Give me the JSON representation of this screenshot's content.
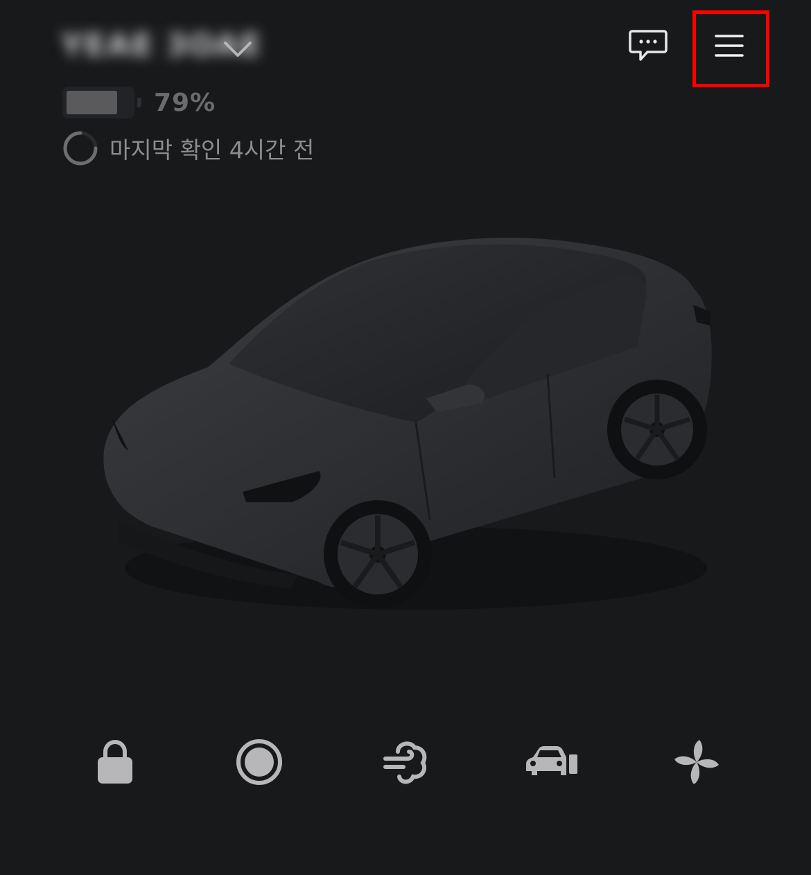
{
  "header": {
    "vehicle_name": "YEAE 3OAE",
    "vehicle_selector_icon": "chevron-down-icon",
    "messages_icon": "chat-bubble-icon",
    "menu_icon": "hamburger-menu-icon"
  },
  "battery": {
    "percent_label": "79%",
    "level": 0.79
  },
  "status": {
    "icon": "loading-spinner-icon",
    "last_seen_text": "마지막 확인 4시간 전"
  },
  "controls": [
    {
      "name": "lock",
      "icon": "lock-icon"
    },
    {
      "name": "sentry",
      "icon": "record-icon"
    },
    {
      "name": "climate",
      "icon": "defrost-air-icon"
    },
    {
      "name": "frunk",
      "icon": "car-trunk-icon"
    },
    {
      "name": "fan",
      "icon": "fan-icon"
    }
  ],
  "colors": {
    "background": "#18191b",
    "icon": "#b7b7b9",
    "highlight": "#ff0000"
  }
}
